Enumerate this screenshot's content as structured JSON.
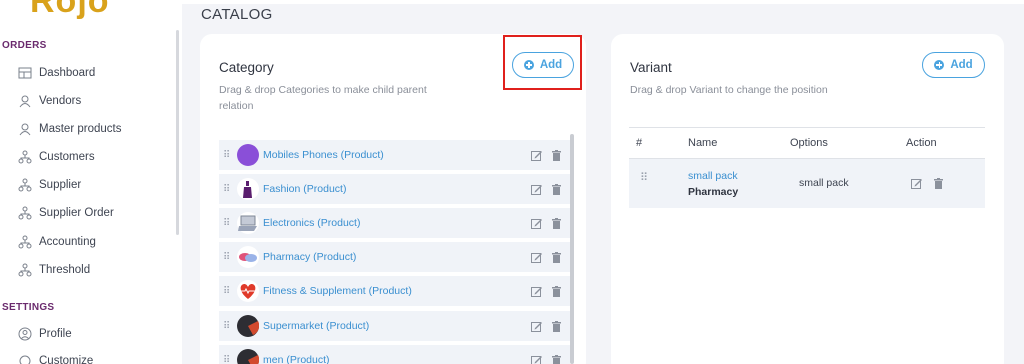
{
  "sidebar": {
    "logo": "Rojo",
    "orders_section": "ORDERS",
    "settings_section": "SETTINGS",
    "items": [
      {
        "label": "Dashboard",
        "icon": "dashboard-icon"
      },
      {
        "label": "Vendors",
        "icon": "user-icon"
      },
      {
        "label": "Master products",
        "icon": "user-icon"
      },
      {
        "label": "Customers",
        "icon": "network-icon"
      },
      {
        "label": "Supplier",
        "icon": "network-icon"
      },
      {
        "label": "Supplier Order",
        "icon": "network-icon"
      },
      {
        "label": "Accounting",
        "icon": "network-icon"
      },
      {
        "label": "Threshold",
        "icon": "network-icon"
      }
    ],
    "settings_items": [
      {
        "label": "Profile",
        "icon": "profile-icon"
      },
      {
        "label": "Customize",
        "icon": "customize-icon"
      }
    ]
  },
  "page": {
    "title": "CATALOG"
  },
  "category": {
    "title": "Category",
    "subtitle_line1": "Drag & drop Categories to make child parent",
    "subtitle_line2": "relation",
    "add_label": "Add",
    "items": [
      {
        "label": "Mobiles Phones (Product)",
        "thumb_color": "#8a4fd8"
      },
      {
        "label": "Fashion (Product)",
        "thumb_color": "#5a1e6e"
      },
      {
        "label": "Electronics (Product)",
        "thumb_color": "#9aa4b8"
      },
      {
        "label": "Pharmacy (Product)",
        "thumb_color": "#d9577a"
      },
      {
        "label": "Fitness & Supplement (Product)",
        "thumb_color": "#e03a2a"
      },
      {
        "label": "Supermarket (Product)",
        "thumb_color": "#2d2d33"
      },
      {
        "label": "men (Product)",
        "thumb_color": "#2d2d33"
      }
    ]
  },
  "variant": {
    "title": "Variant",
    "subtitle": "Drag & drop Variant to change the position",
    "add_label": "Add",
    "columns": {
      "hash": "#",
      "name": "Name",
      "options": "Options",
      "action": "Action"
    },
    "rows": [
      {
        "name": "small pack",
        "sub": "Pharmacy",
        "options": "small pack"
      }
    ]
  },
  "colors": {
    "accent": "#4aa3df",
    "highlight": "#e0201c",
    "section": "#6a2a6d"
  }
}
